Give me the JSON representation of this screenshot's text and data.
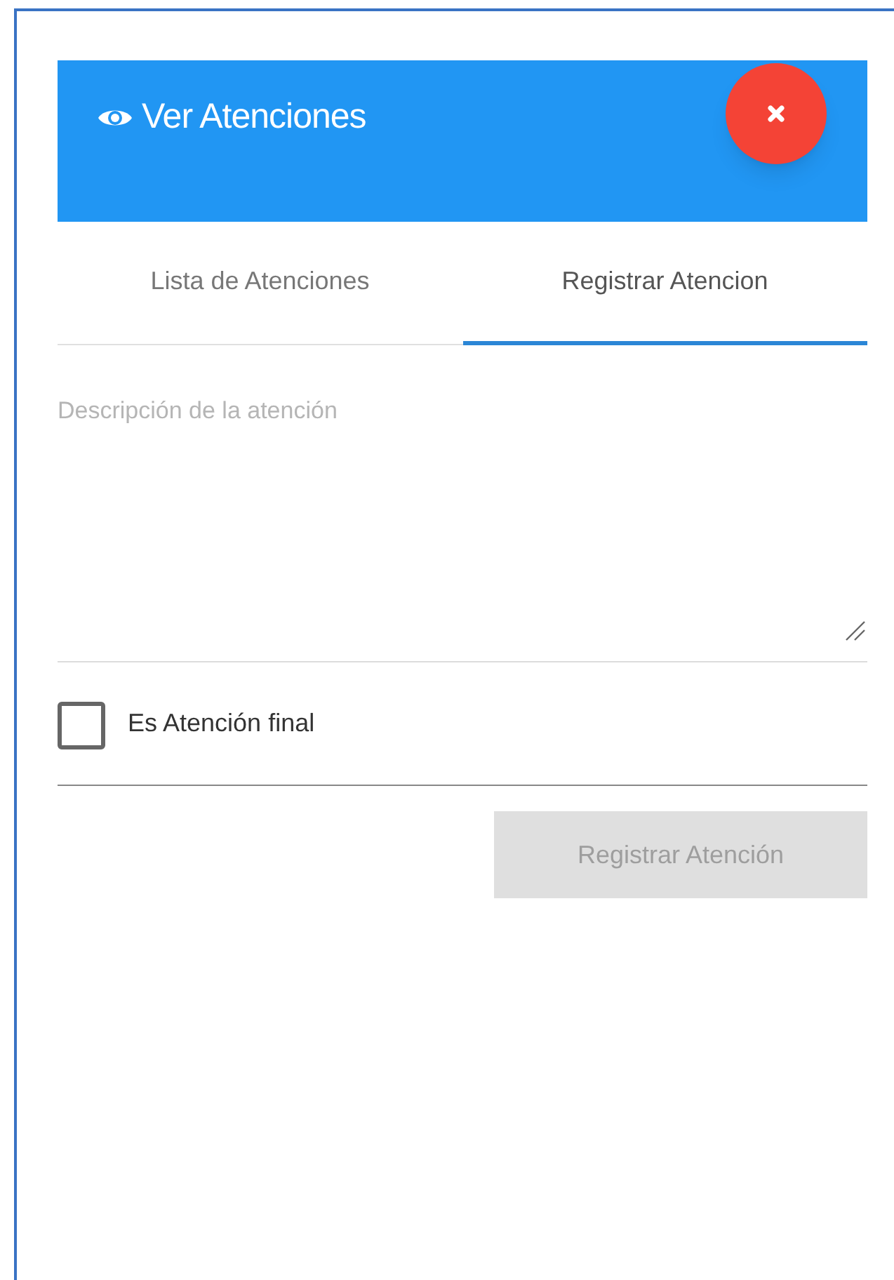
{
  "header": {
    "title": "Ver Atenciones"
  },
  "tabs": [
    {
      "label": "Lista de Atenciones",
      "selected": false
    },
    {
      "label": "Registrar Atencion",
      "selected": true
    }
  ],
  "description": {
    "placeholder": "Descripción de la atención"
  },
  "final_checkbox": {
    "label": "Es Atención final",
    "checked": false
  },
  "submit_button": {
    "label": "Registrar Atención",
    "disabled": true
  }
}
